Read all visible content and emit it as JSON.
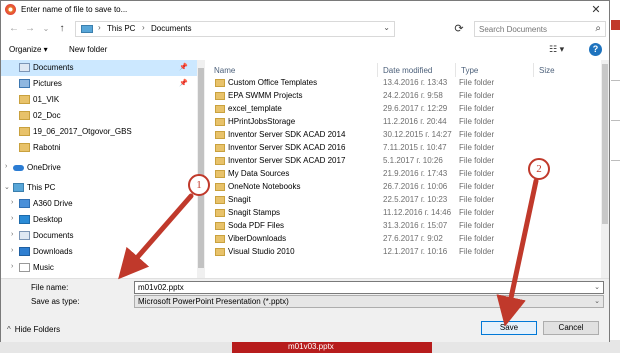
{
  "window": {
    "title": "Enter name of file to save to...",
    "close_glyph": "✕"
  },
  "address": {
    "crumbs": [
      "This PC",
      "Documents"
    ],
    "search_placeholder": "Search Documents"
  },
  "toolbar": {
    "organize_label": "Organize ▾",
    "new_folder_label": "New folder"
  },
  "nav": {
    "items": [
      {
        "label": "Documents",
        "icon": "documents-icon",
        "selected": true,
        "pinned": true
      },
      {
        "label": "Pictures",
        "icon": "pictures-icon",
        "pinned": true
      },
      {
        "label": "01_VIK",
        "icon": "folder-icon"
      },
      {
        "label": "02_Doc",
        "icon": "folder-icon"
      },
      {
        "label": "19_06_2017_Otgovor_GBS",
        "icon": "folder-icon"
      },
      {
        "label": "Rabotni",
        "icon": "folder-icon"
      },
      {
        "label": "OneDrive",
        "icon": "onedrive-icon",
        "expander": ">"
      },
      {
        "label": "This PC",
        "icon": "this-pc-icon",
        "expander": "v"
      },
      {
        "label": "A360 Drive",
        "icon": "drive-icon",
        "expander": ">"
      },
      {
        "label": "Desktop",
        "icon": "desktop-icon",
        "expander": ">"
      },
      {
        "label": "Documents",
        "icon": "documents-icon",
        "expander": ">"
      },
      {
        "label": "Downloads",
        "icon": "downloads-icon",
        "expander": ">"
      },
      {
        "label": "Music",
        "icon": "music-icon",
        "expander": ">"
      }
    ]
  },
  "list": {
    "columns": [
      "Name",
      "Date modified",
      "Type",
      "Size"
    ],
    "rows": [
      {
        "name": "Custom Office Templates",
        "date": "13.4.2016 г. 13:43",
        "type": "File folder"
      },
      {
        "name": "EPA SWMM Projects",
        "date": "24.2.2016 г. 9:58",
        "type": "File folder"
      },
      {
        "name": "excel_template",
        "date": "29.6.2017 г. 12:29",
        "type": "File folder"
      },
      {
        "name": "HPrintJobsStorage",
        "date": "11.2.2016 г. 20:44",
        "type": "File folder"
      },
      {
        "name": "Inventor Server SDK ACAD 2014",
        "date": "30.12.2015 г. 14:27",
        "type": "File folder"
      },
      {
        "name": "Inventor Server SDK ACAD 2016",
        "date": "7.11.2015 г. 10:47",
        "type": "File folder"
      },
      {
        "name": "Inventor Server SDK ACAD 2017",
        "date": "5.1.2017 г. 10:26",
        "type": "File folder"
      },
      {
        "name": "My Data Sources",
        "date": "21.9.2016 г. 17:43",
        "type": "File folder"
      },
      {
        "name": "OneNote Notebooks",
        "date": "26.7.2016 г. 10:06",
        "type": "File folder"
      },
      {
        "name": "Snagit",
        "date": "22.5.2017 г. 10:23",
        "type": "File folder"
      },
      {
        "name": "Snagit Stamps",
        "date": "11.12.2016 г. 14:46",
        "type": "File folder"
      },
      {
        "name": "Soda PDF Files",
        "date": "31.3.2016 г. 15:07",
        "type": "File folder"
      },
      {
        "name": "ViberDownloads",
        "date": "27.6.2017 г. 9:02",
        "type": "File folder"
      },
      {
        "name": "Visual Studio 2010",
        "date": "12.1.2017 г. 10:16",
        "type": "File folder"
      }
    ]
  },
  "form": {
    "file_name_label": "File name:",
    "file_name_value": "m01v02.pptx",
    "save_type_label": "Save as type:",
    "save_type_value": "Microsoft PowerPoint Presentation (*.pptx)",
    "hide_folders_label": "Hide Folders",
    "save_label": "Save",
    "cancel_label": "Cancel"
  },
  "callouts": {
    "one": "1",
    "two": "2"
  },
  "background": {
    "tab_text": "m01v03.pptx"
  },
  "colors": {
    "accent": "#c0392b",
    "selection": "#cce8ff",
    "primary_button": "#0078d7"
  }
}
